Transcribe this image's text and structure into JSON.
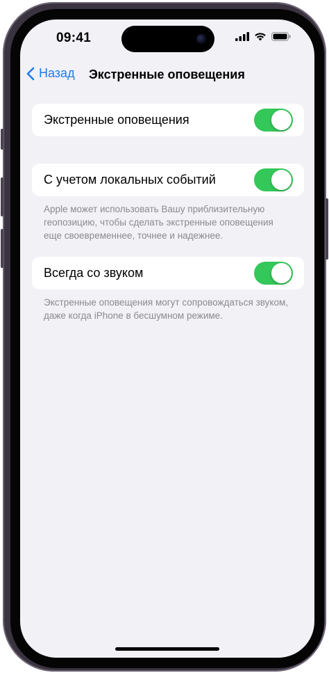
{
  "status_bar": {
    "time": "09:41",
    "icons": [
      "cellular-signal-icon",
      "wifi-icon",
      "battery-icon"
    ]
  },
  "nav": {
    "back_label": "Назад",
    "title": "Экстренные оповещения"
  },
  "settings": [
    {
      "label": "Экстренные оповещения",
      "enabled": true,
      "footer": ""
    },
    {
      "label": "С учетом локальных событий",
      "enabled": true,
      "footer": "Apple может использовать Вашу приблизительную геопозицию, чтобы сделать экстренные оповещения еще своевременнее, точнее и надежнее."
    },
    {
      "label": "Всегда со звуком",
      "enabled": true,
      "footer": "Экстренные оповещения могут сопровождаться звуком, даже когда iPhone в бесшумном режиме."
    }
  ],
  "colors": {
    "accent": "#1d7cf2",
    "toggle_on": "#34c759",
    "background": "#f1f1f6",
    "footer_text": "#8a8a8e"
  }
}
